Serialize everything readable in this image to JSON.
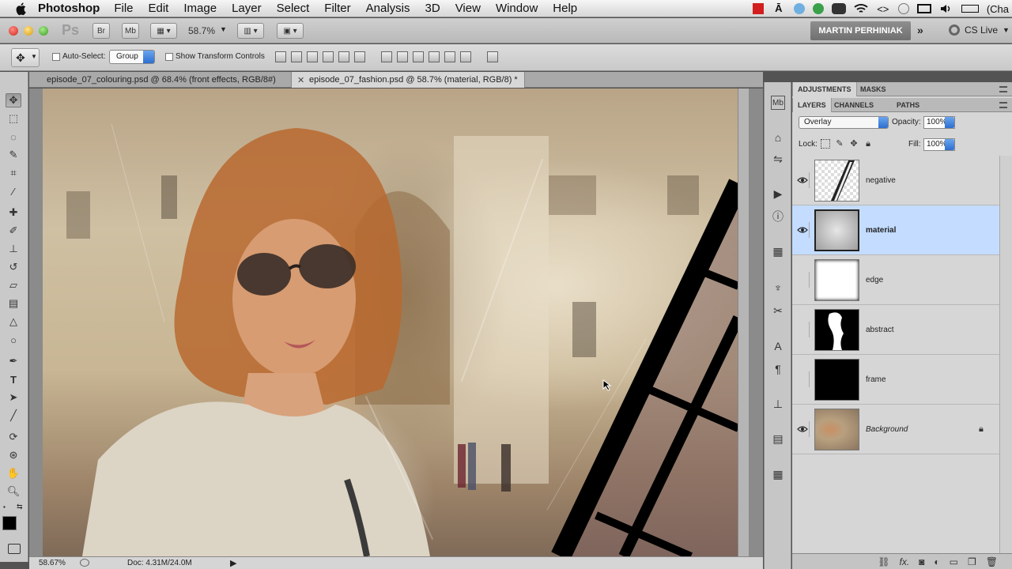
{
  "menubar": {
    "app_name": "Photoshop",
    "items": [
      "File",
      "Edit",
      "Image",
      "Layer",
      "Select",
      "Filter",
      "Analysis",
      "3D",
      "View",
      "Window",
      "Help"
    ],
    "status_tail": "(Cha"
  },
  "appbar": {
    "logo": "Ps",
    "bridge_label": "Br",
    "minibridge_label": "Mb",
    "zoom": "58.7%",
    "user_name": "MARTIN PERHINIAK",
    "cs_live": "CS Live"
  },
  "options": {
    "auto_select_label": "Auto-Select:",
    "auto_select_value": "Group",
    "transform_label": "Show Transform Controls"
  },
  "tabs": [
    {
      "label": "episode_07_colouring.psd @ 68.4% (front effects, RGB/8#)"
    },
    {
      "label": "episode_07_fashion.psd @ 58.7% (material, RGB/8) *"
    }
  ],
  "statusbar": {
    "zoom": "58.67%",
    "doc": "Doc: 4.31M/24.0M"
  },
  "panels": {
    "top_tabs": [
      "ADJUSTMENTS",
      "MASKS"
    ],
    "layer_tabs": [
      "LAYERS",
      "CHANNELS",
      "PATHS"
    ],
    "blend_mode": "Overlay",
    "opacity_label": "Opacity:",
    "opacity_value": "100%",
    "lock_label": "Lock:",
    "fill_label": "Fill:",
    "fill_value": "100%",
    "layers": [
      {
        "name": "negative",
        "visible": true,
        "selected": false
      },
      {
        "name": "material",
        "visible": true,
        "selected": true
      },
      {
        "name": "edge",
        "visible": false,
        "selected": false
      },
      {
        "name": "abstract",
        "visible": false,
        "selected": false
      },
      {
        "name": "frame",
        "visible": false,
        "selected": false
      },
      {
        "name": "Background",
        "visible": true,
        "selected": false,
        "locked": true
      }
    ]
  },
  "colors": {
    "selection": "#c3dcff",
    "accent_blue": "#2d6fd1"
  }
}
